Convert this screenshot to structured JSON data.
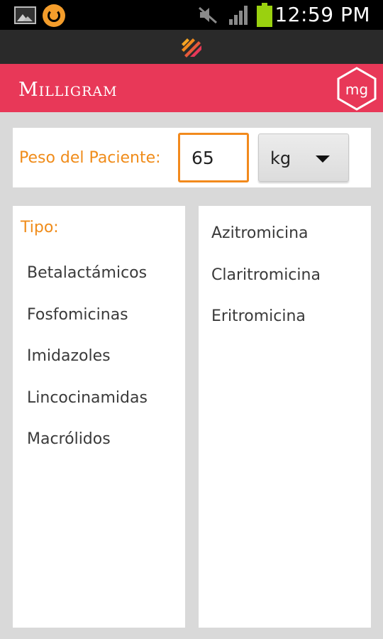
{
  "status_bar": {
    "time": "12:59 PM",
    "icons": [
      "image-icon",
      "sync-icon",
      "mute-icon",
      "signal-icon",
      "battery-icon"
    ],
    "battery_color": "#9ad10f"
  },
  "notification": {
    "icon": "app-notification-icon"
  },
  "app_bar": {
    "title": "Milligram",
    "logo_text": "mg",
    "color": "#e83858"
  },
  "weight": {
    "label": "Peso del Paciente:",
    "value": "65",
    "unit": "kg",
    "accent_color": "#f08c1a"
  },
  "types": {
    "label": "Tipo:",
    "items": [
      "Betalactámicos",
      "Fosfomicinas",
      "Imidazoles",
      "Lincocinamidas",
      "Macrólidos"
    ]
  },
  "drugs": {
    "items": [
      "Azitromicina",
      "Claritromicina",
      "Eritromicina"
    ]
  }
}
